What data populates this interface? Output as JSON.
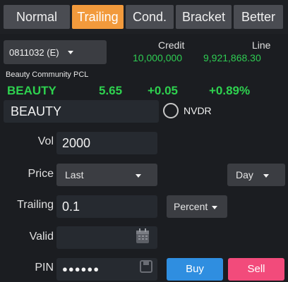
{
  "tabs": [
    {
      "label": "Normal",
      "active": false
    },
    {
      "label": "Trailing",
      "active": true
    },
    {
      "label": "Cond.",
      "active": false
    },
    {
      "label": "Bracket",
      "active": false
    },
    {
      "label": "Better",
      "active": false
    }
  ],
  "account": {
    "selected": "0811032 (E)"
  },
  "credit": {
    "label": "Credit",
    "value": "10,000,000"
  },
  "line": {
    "label": "Line",
    "value": "9,921,868.30"
  },
  "company_name": "Beauty Community PCL",
  "quote": {
    "symbol": "BEAUTY",
    "price": "5.65",
    "change": "+0.05",
    "pct_change": "+0.89%"
  },
  "symbol_input": {
    "value": "BEAUTY"
  },
  "nvdr": {
    "label": "NVDR",
    "checked": false
  },
  "vol": {
    "label": "Vol",
    "value": "2000"
  },
  "price": {
    "label": "Price",
    "type": "Last",
    "validity": "Day"
  },
  "trailing": {
    "label": "Trailing",
    "value": "0.1",
    "unit": "Percent"
  },
  "valid": {
    "label": "Valid",
    "value": ""
  },
  "pin": {
    "label": "PIN",
    "value": "●●●●●●"
  },
  "buttons": {
    "buy": "Buy",
    "sell": "Sell"
  },
  "colors": {
    "accent": "#f29a3c",
    "up": "#2ed24f",
    "buy": "#2f8ee0",
    "sell": "#f24b7b"
  }
}
